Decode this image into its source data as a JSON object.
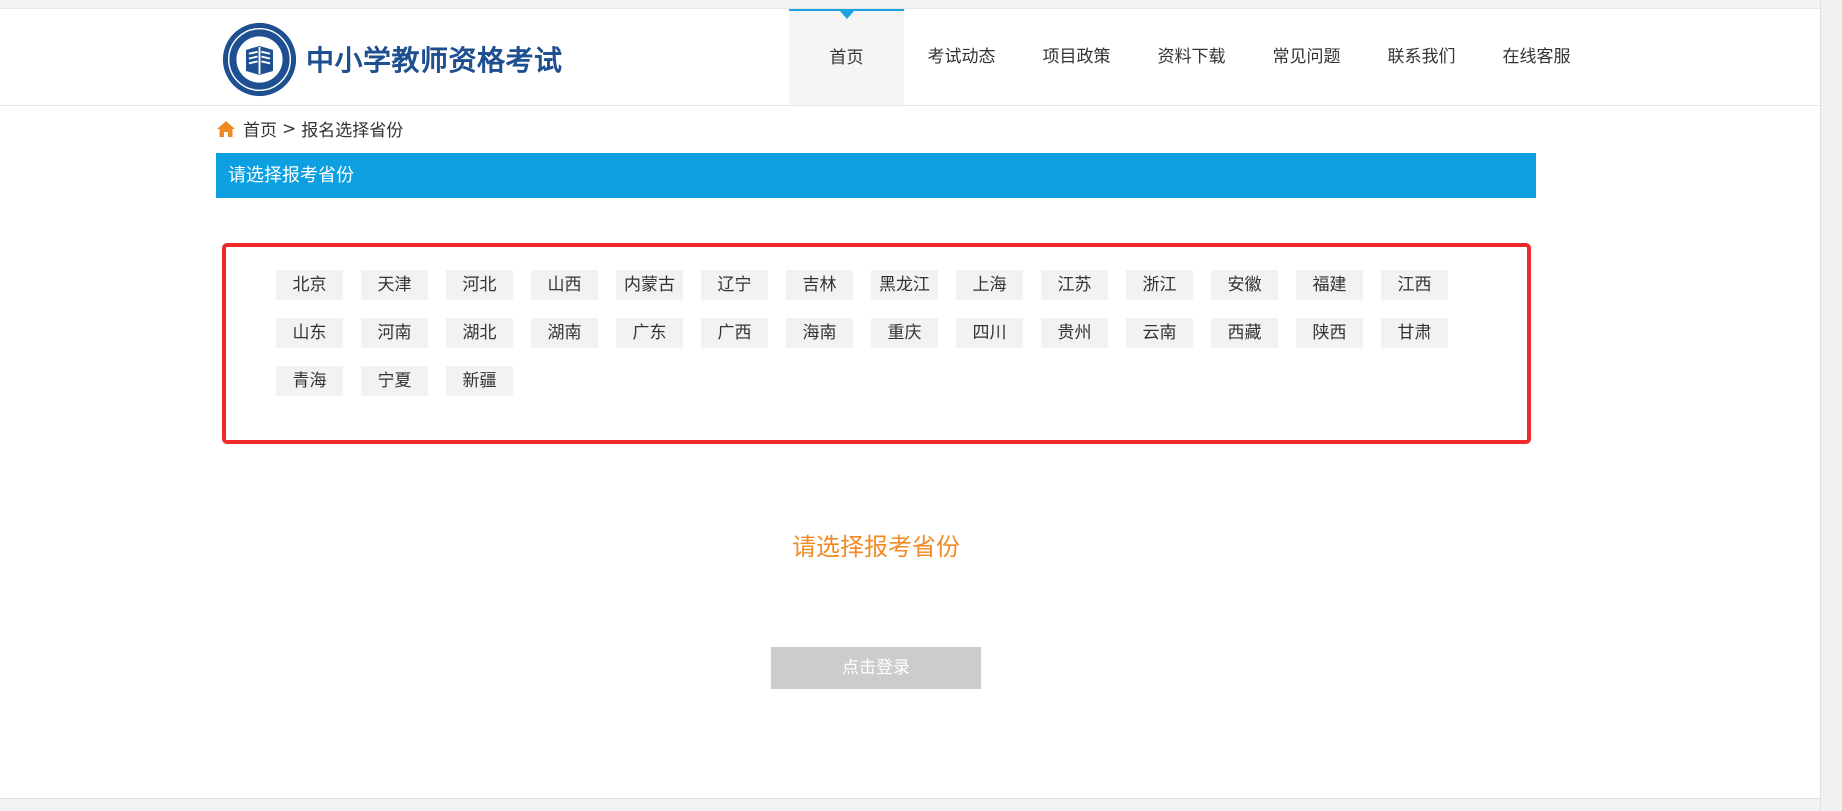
{
  "header": {
    "site_title": "中小学教师资格考试",
    "logo_icon": "seal-book-icon",
    "nav": [
      {
        "label": "首页",
        "active": true
      },
      {
        "label": "考试动态",
        "active": false
      },
      {
        "label": "项目政策",
        "active": false
      },
      {
        "label": "资料下载",
        "active": false
      },
      {
        "label": "常见问题",
        "active": false
      },
      {
        "label": "联系我们",
        "active": false
      },
      {
        "label": "在线客服",
        "active": false
      }
    ]
  },
  "breadcrumb": {
    "icon": "home-icon",
    "home": "首页",
    "separator": ">",
    "current": "报名选择省份"
  },
  "section": {
    "title": "请选择报考省份"
  },
  "provinces": [
    "北京",
    "天津",
    "河北",
    "山西",
    "内蒙古",
    "辽宁",
    "吉林",
    "黑龙江",
    "上海",
    "江苏",
    "浙江",
    "安徽",
    "福建",
    "江西",
    "山东",
    "河南",
    "湖北",
    "湖南",
    "广东",
    "广西",
    "海南",
    "重庆",
    "四川",
    "贵州",
    "云南",
    "西藏",
    "陕西",
    "甘肃",
    "青海",
    "宁夏",
    "新疆"
  ],
  "prompt": "请选择报考省份",
  "login_button": "点击登录",
  "colors": {
    "brand_blue": "#1d4f91",
    "section_bar": "#0da0e0",
    "highlight_border": "#ee2a2a",
    "prompt_orange": "#f08a24",
    "disabled_button": "#cccccc"
  }
}
